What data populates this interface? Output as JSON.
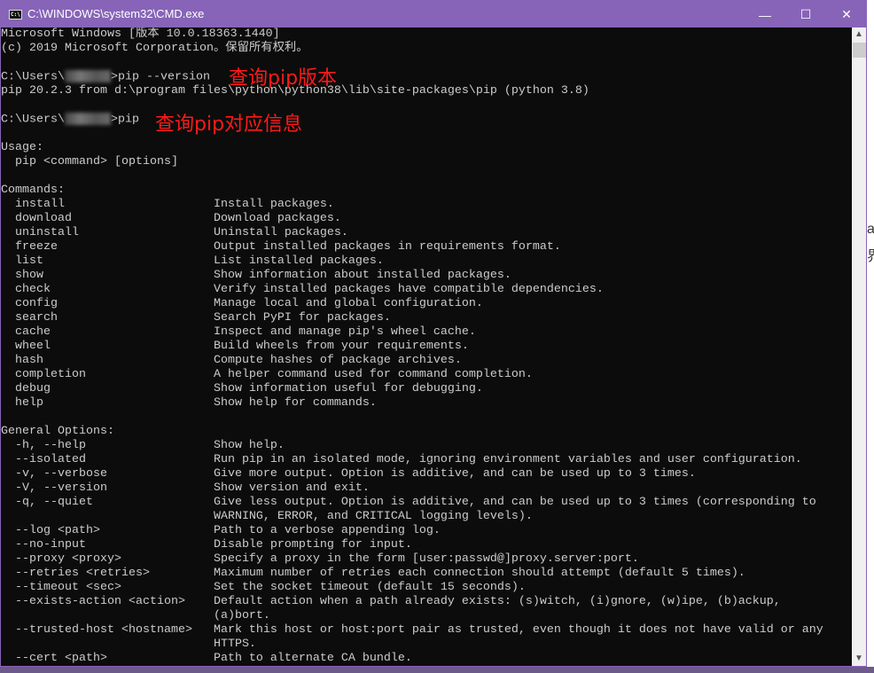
{
  "window": {
    "title": "C:\\WINDOWS\\system32\\CMD.exe",
    "accent_color": "#8764b8",
    "controls": {
      "minimize": "—",
      "maximize": "☐",
      "close": "✕"
    }
  },
  "background": {
    "side_text": [
      "a",
      "界"
    ]
  },
  "terminal": {
    "header": [
      "Microsoft Windows [版本 10.0.18363.1440]",
      "(c) 2019 Microsoft Corporation。保留所有权利。"
    ],
    "prompt_prefix": "C:\\Users\\",
    "cmd1": ">pip --version",
    "cmd1_output": "pip 20.2.3 from d:\\program files\\python\\python38\\lib\\site-packages\\pip (python 3.8)",
    "cmd2": ">pip",
    "body": [
      "",
      "Usage:",
      "  pip <command> [options]",
      "",
      "Commands:",
      "  install                     Install packages.",
      "  download                    Download packages.",
      "  uninstall                   Uninstall packages.",
      "  freeze                      Output installed packages in requirements format.",
      "  list                        List installed packages.",
      "  show                        Show information about installed packages.",
      "  check                       Verify installed packages have compatible dependencies.",
      "  config                      Manage local and global configuration.",
      "  search                      Search PyPI for packages.",
      "  cache                       Inspect and manage pip's wheel cache.",
      "  wheel                       Build wheels from your requirements.",
      "  hash                        Compute hashes of package archives.",
      "  completion                  A helper command used for command completion.",
      "  debug                       Show information useful for debugging.",
      "  help                        Show help for commands.",
      "",
      "General Options:",
      "  -h, --help                  Show help.",
      "  --isolated                  Run pip in an isolated mode, ignoring environment variables and user configuration.",
      "  -v, --verbose               Give more output. Option is additive, and can be used up to 3 times.",
      "  -V, --version               Show version and exit.",
      "  -q, --quiet                 Give less output. Option is additive, and can be used up to 3 times (corresponding to",
      "                              WARNING, ERROR, and CRITICAL logging levels).",
      "  --log <path>                Path to a verbose appending log.",
      "  --no-input                  Disable prompting for input.",
      "  --proxy <proxy>             Specify a proxy in the form [user:passwd@]proxy.server:port.",
      "  --retries <retries>         Maximum number of retries each connection should attempt (default 5 times).",
      "  --timeout <sec>             Set the socket timeout (default 15 seconds).",
      "  --exists-action <action>    Default action when a path already exists: (s)witch, (i)gnore, (w)ipe, (b)ackup,",
      "                              (a)bort.",
      "  --trusted-host <hostname>   Mark this host or host:port pair as trusted, even though it does not have valid or any",
      "                              HTTPS.",
      "  --cert <path>               Path to alternate CA bundle."
    ]
  },
  "annotations": {
    "note1": "查询pip版本",
    "note2": "查询pip对应信息",
    "color": "#ff1a1a"
  }
}
